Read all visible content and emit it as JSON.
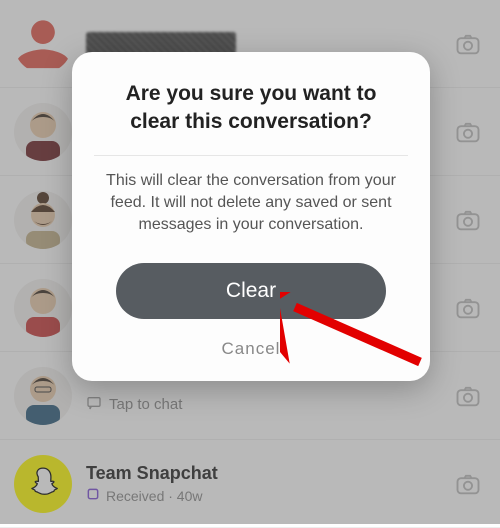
{
  "dialog": {
    "title": "Are you sure you want to clear this conversation?",
    "body": "This will clear the conversation from your feed. It will not delete any saved or sent messages in your conversation.",
    "clear_label": "Clear",
    "cancel_label": "Cancel"
  },
  "list": {
    "tap_to_chat": "Tap to chat",
    "team_name": "Team Snapchat",
    "team_status": "Received · 40w"
  }
}
